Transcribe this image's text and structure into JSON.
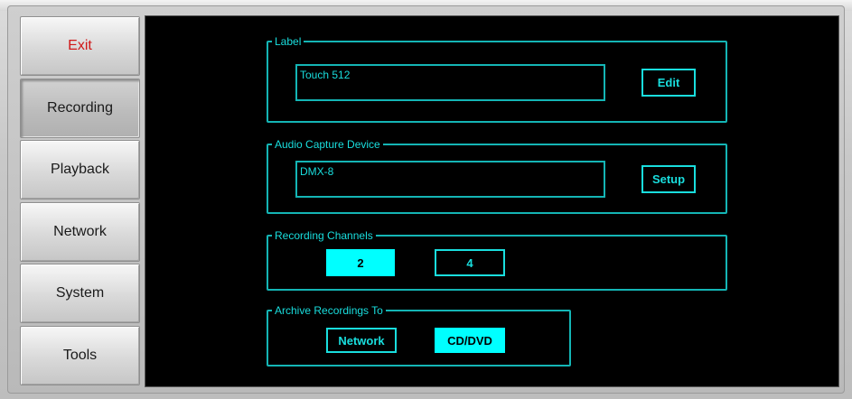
{
  "sidebar": {
    "items": [
      {
        "label": "Exit"
      },
      {
        "label": "Recording"
      },
      {
        "label": "Playback"
      },
      {
        "label": "Network"
      },
      {
        "label": "System"
      },
      {
        "label": "Tools"
      }
    ],
    "active": "Recording"
  },
  "label_group": {
    "title": "Label",
    "value": "Touch 512",
    "button": "Edit"
  },
  "capture_group": {
    "title": "Audio Capture Device",
    "value": "DMX-8",
    "button": "Setup"
  },
  "channels_group": {
    "title": "Recording Channels",
    "options": [
      "2",
      "4"
    ],
    "selected": "2"
  },
  "archive_group": {
    "title": "Archive Recordings To",
    "options": [
      "Network",
      "CD/DVD"
    ],
    "selected": "CD/DVD"
  },
  "colors": {
    "accent": "#14b5b5",
    "selected_fill": "#00ffff",
    "exit_text": "#d01818",
    "panel_bg": "#000000"
  }
}
